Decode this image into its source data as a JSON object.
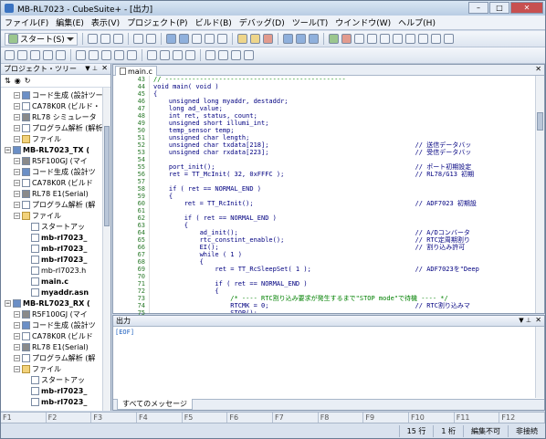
{
  "window": {
    "title": "MB-RL7023 - CubeSuite+ - [出力]"
  },
  "menu": [
    "ファイル(F)",
    "編集(E)",
    "表示(V)",
    "プロジェクト(P)",
    "ビルド(B)",
    "デバッグ(D)",
    "ツール(T)",
    "ウインドウ(W)",
    "ヘルプ(H)"
  ],
  "toolbar": {
    "start_label": "スタート(S)"
  },
  "project_tree": {
    "title": "プロジェクト・ツリー",
    "items": [
      {
        "label": "コード生成 (設計ツー",
        "depth": 2,
        "icon": "prj"
      },
      {
        "label": "CA78K0R (ビルド・",
        "depth": 2,
        "icon": "file"
      },
      {
        "label": "RL78 シミュレータ",
        "depth": 2,
        "icon": "chip"
      },
      {
        "label": "プログラム解析 (解析",
        "depth": 2,
        "icon": "file"
      },
      {
        "label": "ファイル",
        "depth": 2,
        "icon": "fold"
      },
      {
        "label": "MB-RL7023_TX (",
        "depth": 1,
        "icon": "prj",
        "bold": true
      },
      {
        "label": "R5F100GJ (マイ",
        "depth": 2,
        "icon": "chip"
      },
      {
        "label": "コード生成 (設計ツ",
        "depth": 2,
        "icon": "prj"
      },
      {
        "label": "CA78K0R (ビルド",
        "depth": 2,
        "icon": "file"
      },
      {
        "label": "RL78 E1(Serial)",
        "depth": 2,
        "icon": "chip"
      },
      {
        "label": "プログラム解析 (解",
        "depth": 2,
        "icon": "file"
      },
      {
        "label": "ファイル",
        "depth": 2,
        "icon": "fold"
      },
      {
        "label": "スタートアッ",
        "depth": 3,
        "icon": "file"
      },
      {
        "label": "mb-rl7023_",
        "depth": 3,
        "icon": "file",
        "bold": true
      },
      {
        "label": "mb-rl7023_",
        "depth": 3,
        "icon": "file",
        "bold": true
      },
      {
        "label": "mb-rl7023_",
        "depth": 3,
        "icon": "file",
        "bold": true
      },
      {
        "label": "mb-rl7023.h",
        "depth": 3,
        "icon": "file"
      },
      {
        "label": "main.c",
        "depth": 3,
        "icon": "file",
        "bold": true
      },
      {
        "label": "myaddr.asn",
        "depth": 3,
        "icon": "file",
        "bold": true
      },
      {
        "label": "MB-RL7023_RX (",
        "depth": 1,
        "icon": "prj",
        "bold": true
      },
      {
        "label": "R5F100GJ (マイ",
        "depth": 2,
        "icon": "chip"
      },
      {
        "label": "コード生成 (設計ツ",
        "depth": 2,
        "icon": "prj"
      },
      {
        "label": "CA78K0R (ビルド",
        "depth": 2,
        "icon": "file"
      },
      {
        "label": "RL78 E1(Serial)",
        "depth": 2,
        "icon": "chip"
      },
      {
        "label": "プログラム解析 (解",
        "depth": 2,
        "icon": "file"
      },
      {
        "label": "ファイル",
        "depth": 2,
        "icon": "fold"
      },
      {
        "label": "スタートアッ",
        "depth": 3,
        "icon": "file"
      },
      {
        "label": "mb-rl7023_",
        "depth": 3,
        "icon": "file",
        "bold": true
      },
      {
        "label": "mb-rl7023_",
        "depth": 3,
        "icon": "file",
        "bold": true
      }
    ]
  },
  "editor": {
    "tab": "main.c",
    "line_numbers": [
      "43",
      "44",
      "45",
      "46",
      "47",
      "48",
      "49",
      "50",
      "51",
      "52",
      "53",
      "54",
      "55",
      "56",
      "57",
      "58",
      "59",
      "60",
      "61",
      "62",
      "63",
      "64",
      "65",
      "66",
      "67",
      "68",
      "69",
      "70",
      "71",
      "72",
      "73",
      "74",
      "75"
    ],
    "lines": [
      "// -----------------------------------------------",
      "void main( void )",
      "{",
      "    unsigned long myaddr, destaddr;",
      "    long ad_value;",
      "    int ret, status, count;",
      "    unsigned short illumi_int;",
      "    temp_sensor temp;",
      "    unsigned char length;",
      "    unsigned char txdata[218];                                      // 送信データバッ",
      "    unsigned char rxdata[223];                                      // 受信データバッ",
      "",
      "    port_init();                                                    // ポート初期設定",
      "    ret = TT_McInit( 32, 0xFFFC );                                  // RL78/G13 初期",
      "",
      "    if ( ret == NORMAL_END )",
      "    {",
      "        ret = TT_RcInit();                                          // ADF7023 初期設",
      "",
      "        if ( ret == NORMAL_END )",
      "        {",
      "            ad_init();                                              // A/Dコンバータ",
      "            rtc_constint_enable();                                  // RTC定周期割り",
      "            EI();                                                   // 割り込み許可",
      "            while ( 1 )",
      "            {",
      "                ret = TT_RcSleepSet( 1 );                           // ADF7023を\"Deep",
      "",
      "                if ( ret == NORMAL_END )",
      "                {",
      "                    /* ---- RTC割り込み要求が発生するまで\"STOP mode\"で待機 ---- */",
      "                    RTCMK = 0;                                      // RTC割り込みマ",
      "                    STOP();"
    ]
  },
  "output": {
    "title": "出力",
    "content": "[EOF]",
    "tab": "すべてのメッセージ"
  },
  "function_keys": [
    "F1",
    "F2",
    "F3",
    "F4",
    "F5",
    "F6",
    "F7",
    "F8",
    "F9",
    "F10",
    "F11",
    "F12"
  ],
  "statusbar": {
    "line": "15 行",
    "column": "1 桁",
    "mode": "編集不可",
    "connection": "非接続"
  }
}
